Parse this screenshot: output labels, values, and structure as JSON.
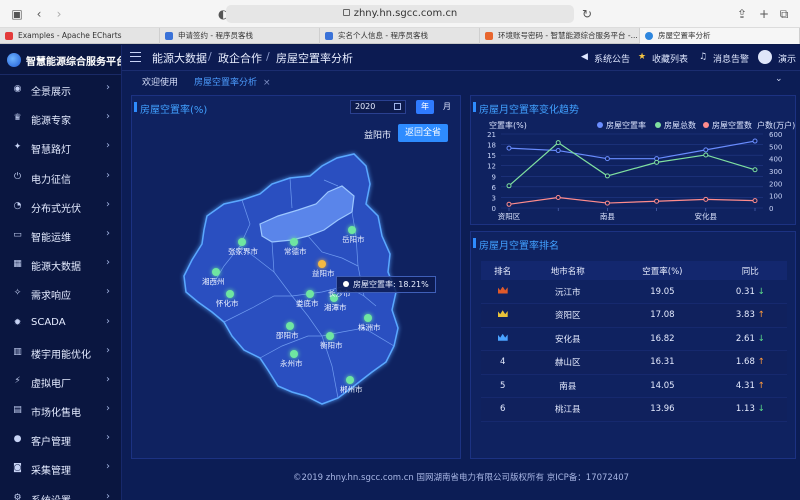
{
  "browser": {
    "url": "zhny.hn.sgcc.com.cn",
    "tabs": [
      {
        "title": "Examples - Apache ECharts",
        "color": "#e33a3a"
      },
      {
        "title": "申请签约 - 程序员客栈",
        "color": "#3a72d8"
      },
      {
        "title": "实名个人信息 - 程序员客栈",
        "color": "#3a72d8"
      },
      {
        "title": "环境账号密码 - 智慧能源综合服务平台 -...",
        "color": "#e8662e"
      },
      {
        "title": "房屋空置率分析",
        "color": "#2e86de"
      }
    ]
  },
  "app": {
    "title": "智慧能源综合服务平台",
    "breadcrumb": [
      "能源大数据",
      "政企合作",
      "房屋空置率分析"
    ],
    "header_actions": [
      "系统公告",
      "收藏列表",
      "消息告警",
      "演示"
    ],
    "subtabs": [
      "欢迎使用",
      "房屋空置率分析"
    ]
  },
  "sidebar": {
    "items": [
      {
        "label": "全景展示",
        "icon": "location-icon"
      },
      {
        "label": "能源专家",
        "icon": "trophy-icon"
      },
      {
        "label": "智慧路灯",
        "icon": "lamp-icon"
      },
      {
        "label": "电力征信",
        "icon": "power-icon"
      },
      {
        "label": "分布式光伏",
        "icon": "pie-icon"
      },
      {
        "label": "智能运维",
        "icon": "monitor-icon"
      },
      {
        "label": "能源大数据",
        "icon": "data-icon"
      },
      {
        "label": "需求响应",
        "icon": "bulb-icon"
      },
      {
        "label": "SCADA",
        "icon": "gear-icon"
      },
      {
        "label": "楼宇用能优化",
        "icon": "building-icon"
      },
      {
        "label": "虚拟电厂",
        "icon": "plant-icon"
      },
      {
        "label": "市场化售电",
        "icon": "market-icon"
      },
      {
        "label": "客户管理",
        "icon": "user-icon"
      },
      {
        "label": "采集管理",
        "icon": "camera-icon"
      },
      {
        "label": "系统设置",
        "icon": "settings-icon"
      }
    ]
  },
  "left_panel": {
    "title": "房屋空置率(%)",
    "year": "2020",
    "period_year": "年",
    "period_month": "月",
    "selected_city": "益阳市",
    "back_button": "返回全省",
    "tooltip": "房屋空置率: 18.21%",
    "cities": [
      "张家界市",
      "常德市",
      "岳阳市",
      "益阳市",
      "湘西州",
      "怀化市",
      "娄底市",
      "湘潭市",
      "株洲市",
      "邵阳市",
      "衡阳市",
      "永州市",
      "郴州市",
      "长沙市"
    ]
  },
  "trend_panel": {
    "title": "房屋月空置率变化趋势",
    "legend": [
      "房屋空置率",
      "房屋总数",
      "房屋空置数"
    ],
    "colors": {
      "rate": "#6a8dff",
      "total": "#7fe0a0",
      "vacant": "#ff8c8c"
    }
  },
  "chart_data": {
    "type": "line",
    "categories": [
      "资阳区",
      "赫山区",
      "南县",
      "桃江县",
      "安化县",
      "沅江市"
    ],
    "xlabel": "",
    "ylabel_left": "空置率(%)",
    "ylabel_right": "户数(万户)",
    "ylim_left": [
      0,
      21
    ],
    "ylim_right": [
      0,
      600
    ],
    "yticks_left": [
      0,
      3,
      6,
      9,
      12,
      15,
      18,
      21
    ],
    "yticks_right": [
      0,
      100,
      200,
      300,
      400,
      500,
      600
    ],
    "xtick_labels_shown": [
      "资阳区",
      "南县",
      "安化县"
    ],
    "series": [
      {
        "name": "房屋空置率",
        "axis": "left",
        "values": [
          17,
          16.3,
          14,
          14,
          16.5,
          19
        ]
      },
      {
        "name": "房屋总数",
        "axis": "right",
        "values": [
          180,
          530,
          260,
          370,
          430,
          310
        ]
      },
      {
        "name": "房屋空置数",
        "axis": "right",
        "values": [
          30,
          85,
          40,
          55,
          70,
          60
        ]
      }
    ]
  },
  "rank_panel": {
    "title": "房屋月空置率排名",
    "columns": [
      "排名",
      "地市名称",
      "空置率(%)",
      "同比"
    ],
    "rows": [
      {
        "rank": "",
        "medal": "#e05a2a",
        "city": "沅江市",
        "rate": "19.05",
        "yoy": "0.31",
        "dir": "down"
      },
      {
        "rank": "",
        "medal": "#e8c23a",
        "city": "资阳区",
        "rate": "17.08",
        "yoy": "3.83",
        "dir": "up"
      },
      {
        "rank": "",
        "medal": "#4aa3ff",
        "city": "安化县",
        "rate": "16.82",
        "yoy": "2.61",
        "dir": "down"
      },
      {
        "rank": "4",
        "medal": "",
        "city": "赫山区",
        "rate": "16.31",
        "yoy": "1.68",
        "dir": "up"
      },
      {
        "rank": "5",
        "medal": "",
        "city": "南县",
        "rate": "14.05",
        "yoy": "4.31",
        "dir": "up"
      },
      {
        "rank": "6",
        "medal": "",
        "city": "桃江县",
        "rate": "13.96",
        "yoy": "1.13",
        "dir": "down"
      }
    ],
    "arrows": {
      "up": "↑",
      "down": "↓"
    }
  },
  "footer": "©2019 zhny.hn.sgcc.com.cn 国网湖南省电力有限公司版权所有 京ICP备：17072407"
}
